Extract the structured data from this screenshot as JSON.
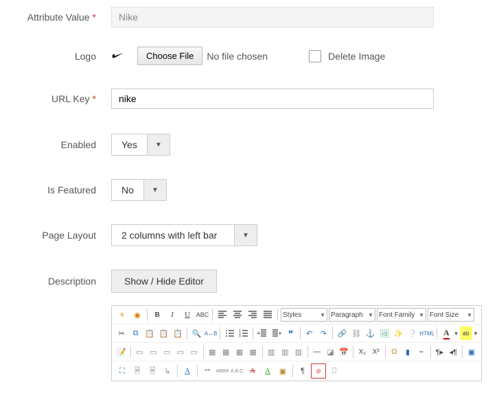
{
  "fields": {
    "attribute_value": {
      "label": "Attribute Value",
      "value": "Nike"
    },
    "logo": {
      "label": "Logo",
      "choose_file_btn": "Choose File",
      "no_file_text": "No file chosen",
      "delete_image_label": "Delete Image"
    },
    "url_key": {
      "label": "URL Key",
      "value": "nike"
    },
    "enabled": {
      "label": "Enabled",
      "value": "Yes"
    },
    "is_featured": {
      "label": "Is Featured",
      "value": "No"
    },
    "page_layout": {
      "label": "Page Layout",
      "value": "2 columns with left bar"
    },
    "description": {
      "label": "Description",
      "toggle_btn": "Show / Hide Editor"
    }
  },
  "editor": {
    "dropdowns": {
      "styles": "Styles",
      "paragraph": "Paragraph",
      "font_family": "Font Family",
      "font_size": "Font Size"
    },
    "html_btn": "HTML"
  }
}
